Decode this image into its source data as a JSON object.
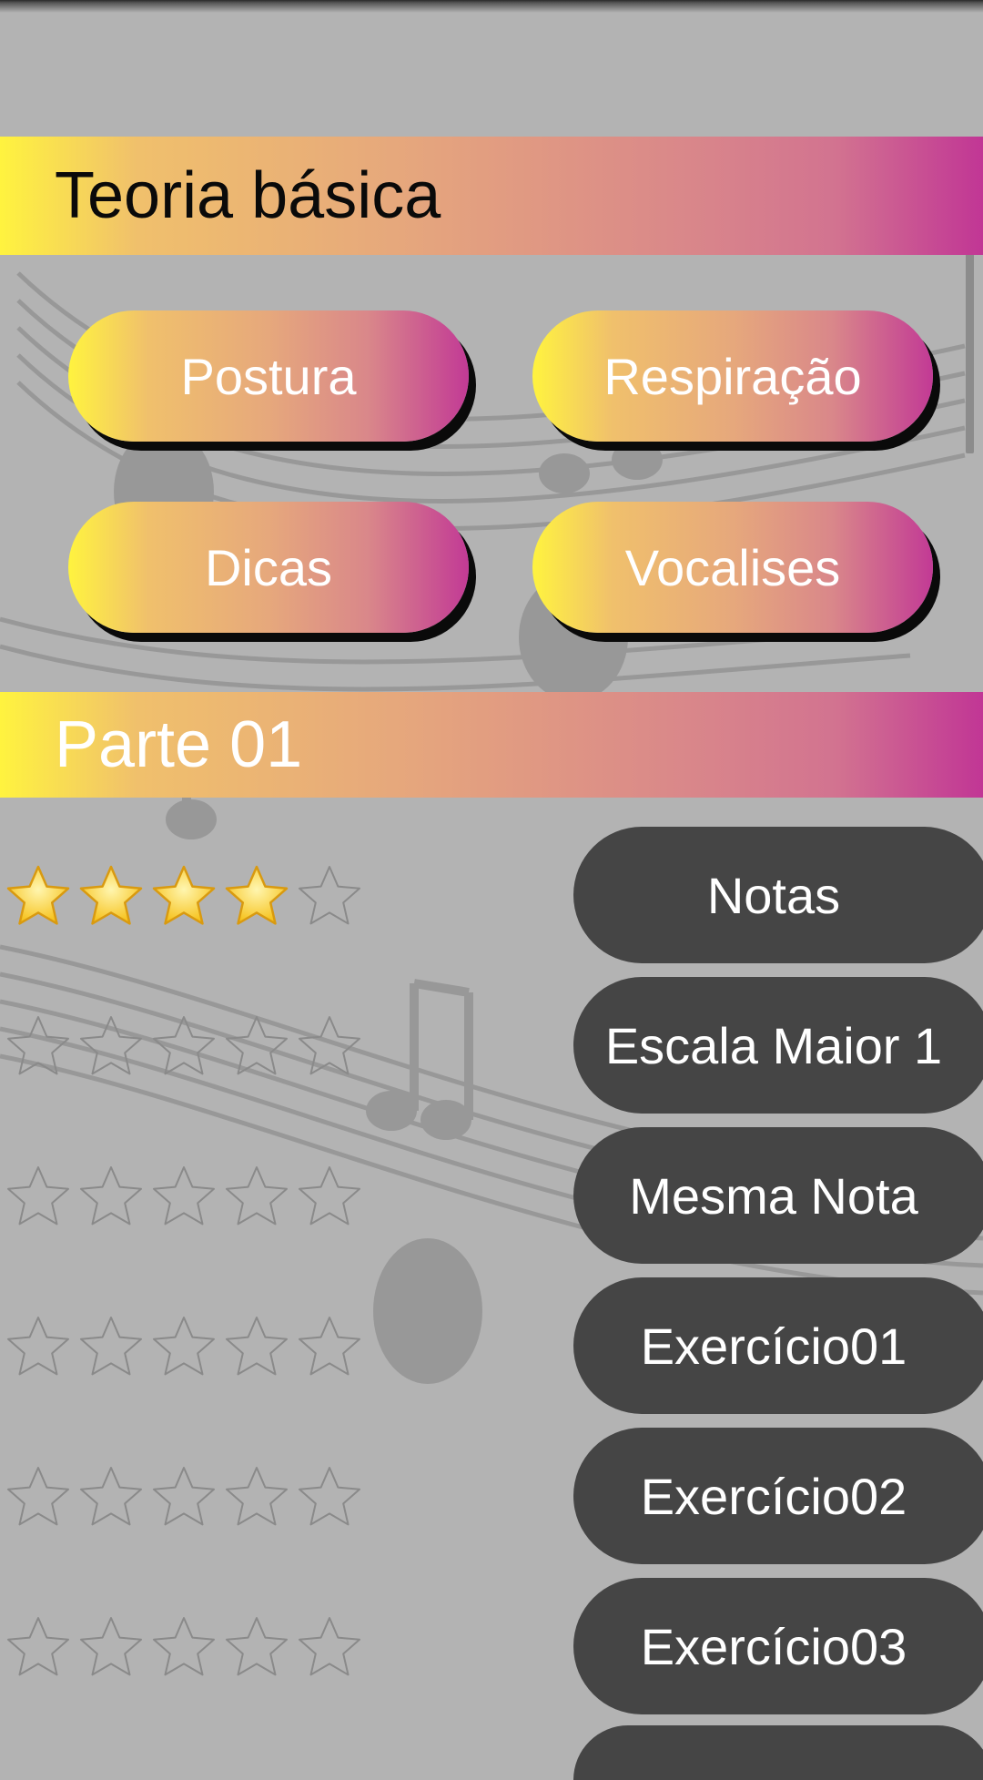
{
  "colors": {
    "background": "#b3b3b3",
    "gradient_start": "#fff33f",
    "gradient_end": "#c13695",
    "exercise_button": "#454545",
    "star_filled": "#f6c21c",
    "star_empty_outline": "#8a8a8a"
  },
  "header_basic": {
    "title": "Teoria básica"
  },
  "basic_buttons": [
    {
      "label": "Postura"
    },
    {
      "label": "Respiração"
    },
    {
      "label": "Dicas"
    },
    {
      "label": "Vocalises"
    }
  ],
  "header_part": {
    "title": "Parte 01"
  },
  "exercises": [
    {
      "label": "Notas",
      "rating": 4,
      "max_rating": 5
    },
    {
      "label": "Escala Maior 1",
      "rating": 0,
      "max_rating": 5
    },
    {
      "label": "Mesma Nota",
      "rating": 0,
      "max_rating": 5
    },
    {
      "label": "Exercício01",
      "rating": 0,
      "max_rating": 5
    },
    {
      "label": "Exercício02",
      "rating": 0,
      "max_rating": 5
    },
    {
      "label": "Exercício03",
      "rating": 0,
      "max_rating": 5
    }
  ],
  "icons": {
    "background": "music-notes-background",
    "rating": "star-icon"
  }
}
